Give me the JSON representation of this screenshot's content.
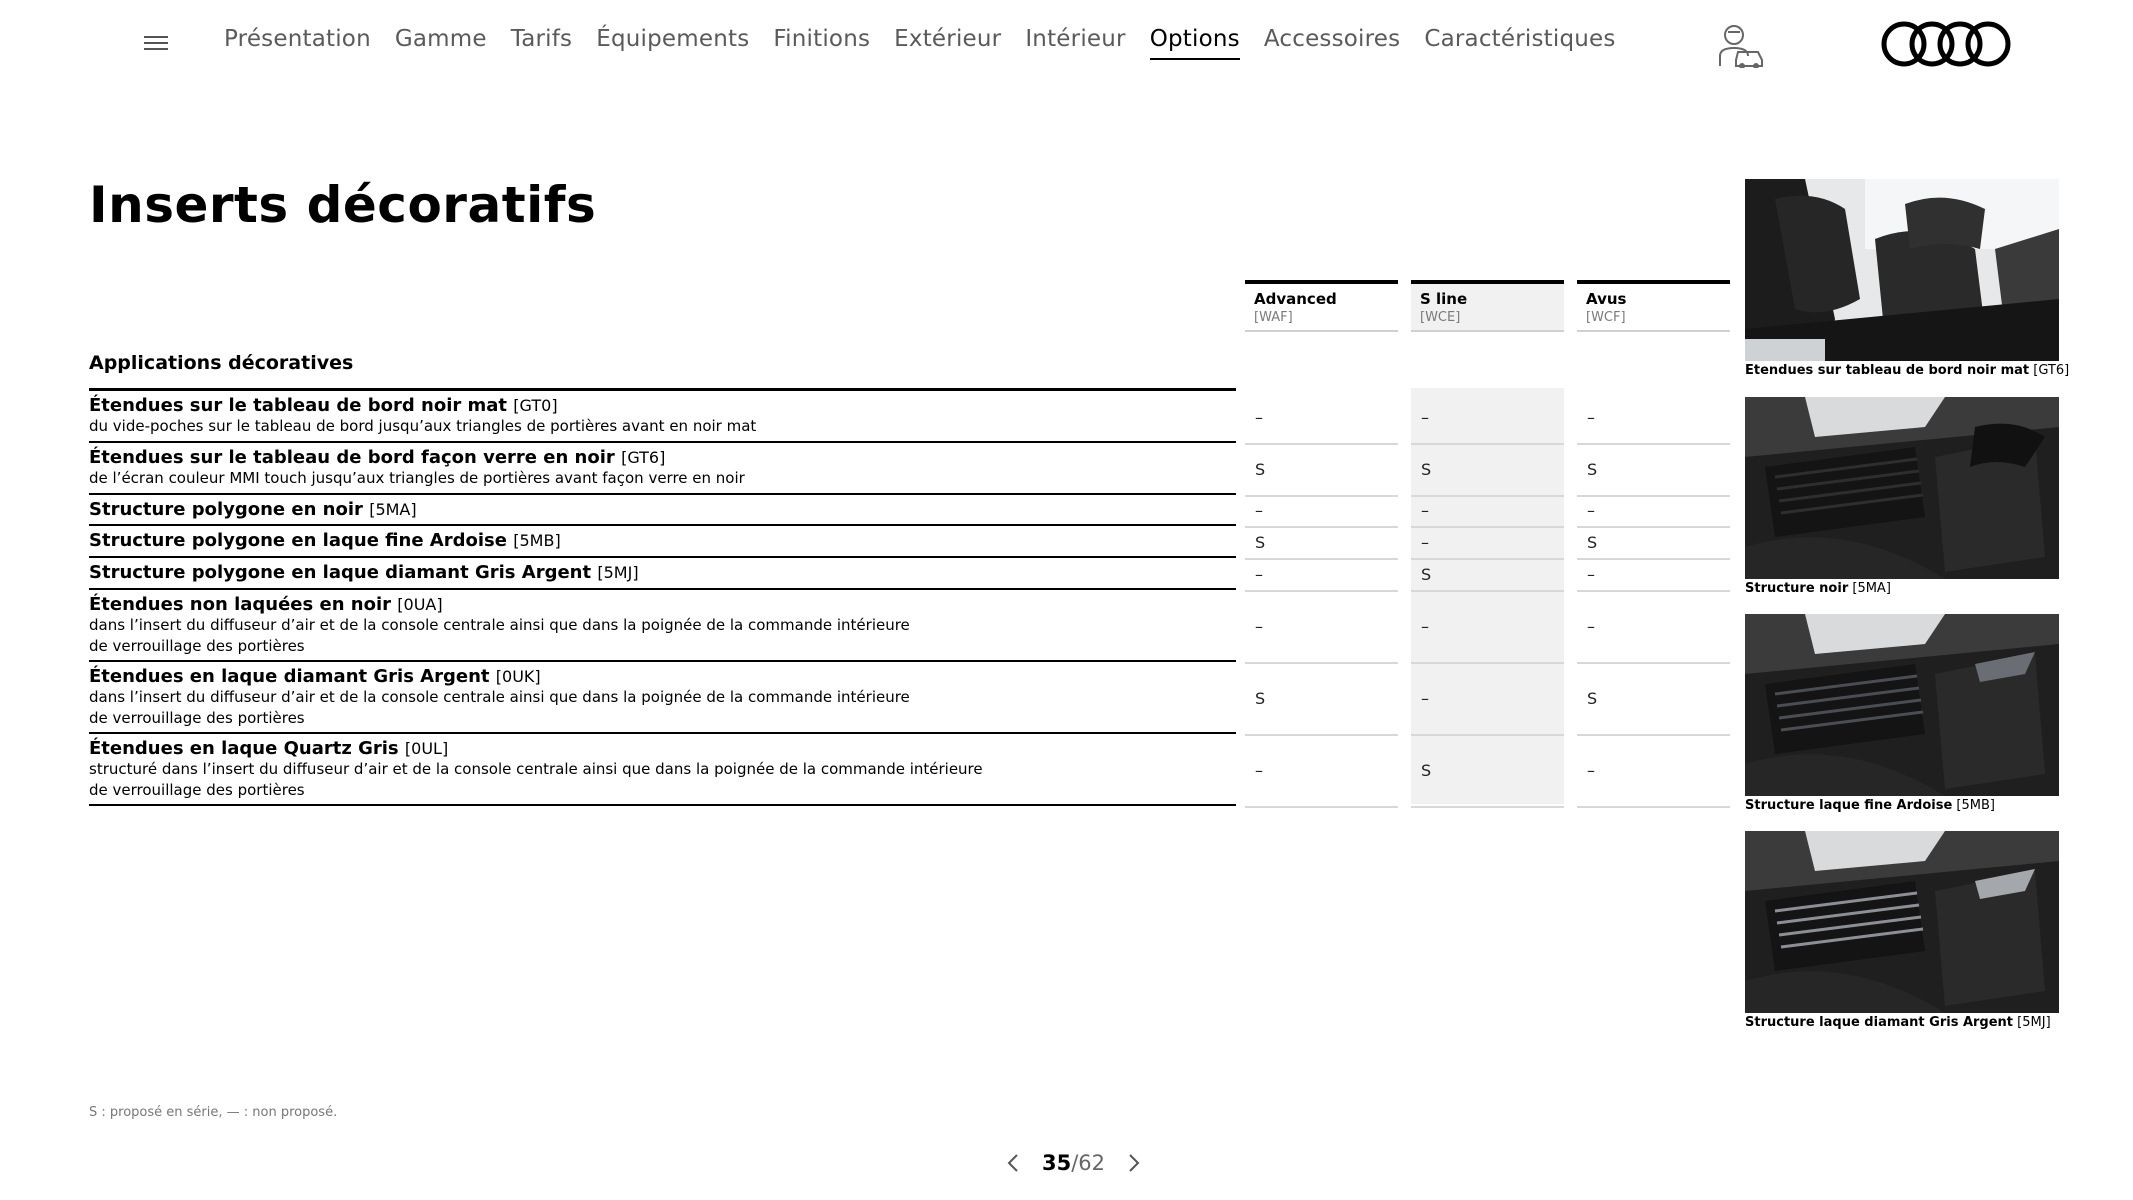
{
  "nav": {
    "items": [
      "Présentation",
      "Gamme",
      "Tarifs",
      "Équipements",
      "Finitions",
      "Extérieur",
      "Intérieur",
      "Options",
      "Accessoires",
      "Caractéristiques"
    ],
    "active": "Options",
    "icons": {
      "menu": "hamburger-menu-icon",
      "configurator": "configurator-icon",
      "logo": "audi-rings-logo"
    }
  },
  "page": {
    "title": "Inserts décoratifs"
  },
  "section": {
    "title": "Applications décoratives"
  },
  "columns": [
    {
      "name": "Advanced",
      "code": "[WAF]"
    },
    {
      "name": "S line",
      "code": "[WCE]"
    },
    {
      "name": "Avus",
      "code": "[WCF]"
    }
  ],
  "rows": [
    {
      "title": "Étendues sur le tableau de bord noir mat",
      "code": "[GT0]",
      "desc": [
        "du vide-poches sur le tableau de bord jusqu’aux triangles de portières avant en noir mat"
      ],
      "values": [
        "–",
        "–",
        "–"
      ]
    },
    {
      "title": "Étendues sur le tableau de bord façon verre en noir",
      "code": "[GT6]",
      "desc": [
        "de l’écran couleur MMI touch jusqu’aux triangles de portières avant façon verre en noir"
      ],
      "values": [
        "S",
        "S",
        "S"
      ]
    },
    {
      "title": "Structure polygone en noir",
      "code": "[5MA]",
      "desc": [],
      "values": [
        "–",
        "–",
        "–"
      ]
    },
    {
      "title": "Structure polygone en laque fine Ardoise",
      "code": "[5MB]",
      "desc": [],
      "values": [
        "S",
        "–",
        "S"
      ]
    },
    {
      "title": "Structure polygone en laque diamant Gris Argent",
      "code": "[5MJ]",
      "desc": [],
      "values": [
        "–",
        "S",
        "–"
      ]
    },
    {
      "title": "Étendues non laquées en noir",
      "code": "[0UA]",
      "desc": [
        "dans l’insert du diffuseur d’air et de la console centrale ainsi que dans la poignée de la commande intérieure",
        "de verrouillage des portières"
      ],
      "values": [
        "–",
        "–",
        "–"
      ]
    },
    {
      "title": "Étendues en laque diamant Gris Argent",
      "code": "[0UK]",
      "desc": [
        "dans l’insert du diffuseur d’air et de la console centrale ainsi que dans la poignée de la commande intérieure",
        "de verrouillage des portières"
      ],
      "values": [
        "S",
        "–",
        "S"
      ]
    },
    {
      "title": "Étendues en laque Quartz Gris",
      "code": "[0UL]",
      "desc": [
        "structuré dans l’insert du diffuseur d’air  et de la console centrale ainsi que dans la poignée de la commande intérieure",
        "de verrouillage des portières"
      ],
      "values": [
        "–",
        "S",
        "–"
      ]
    }
  ],
  "images": [
    {
      "caption": "Etendues sur tableau de bord noir mat",
      "code": "[GT6]",
      "icon": "car-interior-seats-image"
    },
    {
      "caption": "Structure noir",
      "code": "[5MA]",
      "icon": "dashboard-vent-image"
    },
    {
      "caption": "Structure laque fine Ardoise",
      "code": "[5MB]",
      "icon": "dashboard-vent-image"
    },
    {
      "caption": "Structure laque diamant Gris Argent",
      "code": "[5MJ]",
      "icon": "dashboard-vent-image"
    }
  ],
  "footer": {
    "legend": "S : proposé en série, — : non proposé.",
    "page_current": "35",
    "page_total": "/62"
  }
}
